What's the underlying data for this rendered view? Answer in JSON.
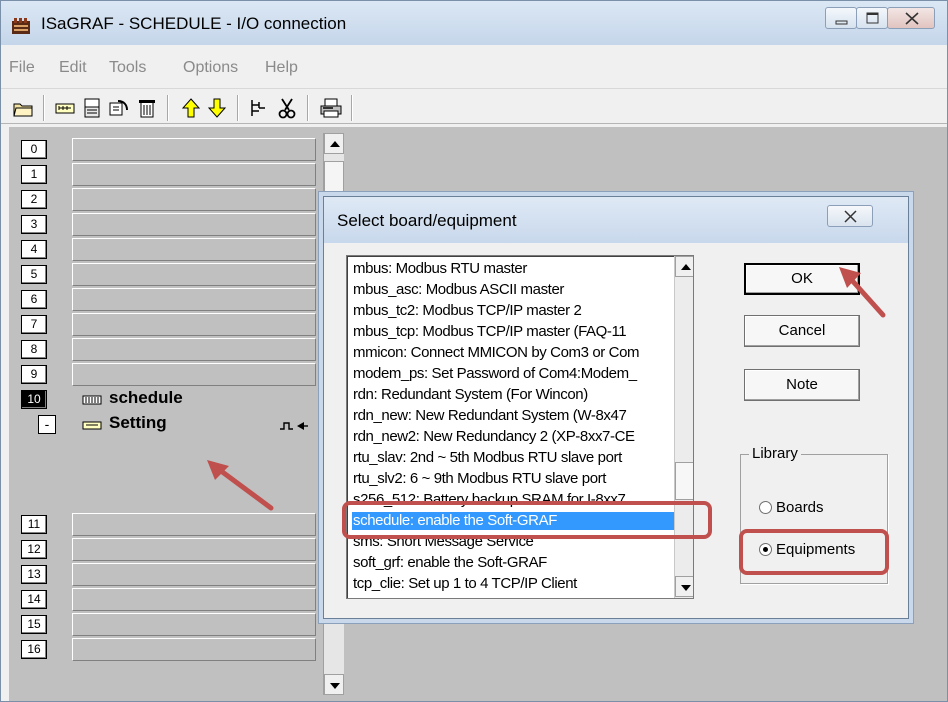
{
  "window": {
    "title": "ISaGRAF - SCHEDULE - I/O connection"
  },
  "menubar": {
    "items": [
      "File",
      "Edit",
      "Tools",
      "Options",
      "Help"
    ]
  },
  "slots": {
    "rows_top": [
      "0",
      "1",
      "2",
      "3",
      "4",
      "5",
      "6",
      "7",
      "8",
      "9"
    ],
    "active_slot": "10",
    "active_label": "schedule",
    "sub_toggle": "-",
    "sub_label": "Setting",
    "rows_bottom": [
      "11",
      "12",
      "13",
      "14",
      "15",
      "16"
    ]
  },
  "dialog": {
    "title": "Select board/equipment",
    "close_glyph": "☒",
    "list_items": [
      "mbus: Modbus RTU master",
      "mbus_asc: Modbus ASCII master",
      "mbus_tc2: Modbus TCP/IP master 2",
      "mbus_tcp: Modbus TCP/IP master (FAQ-11",
      "mmicon: Connect MMICON by Com3 or Com",
      "modem_ps: Set Password of Com4:Modem_",
      "rdn: Redundant System (For Wincon)",
      "rdn_new: New Redundant System (W-8x47",
      "rdn_new2: New Redundancy 2 (XP-8xx7-CE",
      "rtu_slav: 2nd ~ 5th Modbus RTU slave port",
      "rtu_slv2: 6 ~ 9th Modbus RTU slave port",
      "s256_512: Battery backup SRAM for I-8xx7",
      "schedule: enable the Soft-GRAF",
      "sms: Short Message Service",
      "soft_grf: enable the Soft-GRAF",
      "tcp_clie: Set up 1 to 4 TCP/IP Client"
    ],
    "selected_index": 12,
    "buttons": {
      "ok": "OK",
      "cancel": "Cancel",
      "note": "Note"
    },
    "library": {
      "label": "Library",
      "options": [
        "Boards",
        "Equipments"
      ],
      "selected": "Equipments"
    }
  },
  "colors": {
    "highlight": "#c0504d",
    "selection": "#3399ff",
    "client_bg": "#c0c0c0"
  }
}
